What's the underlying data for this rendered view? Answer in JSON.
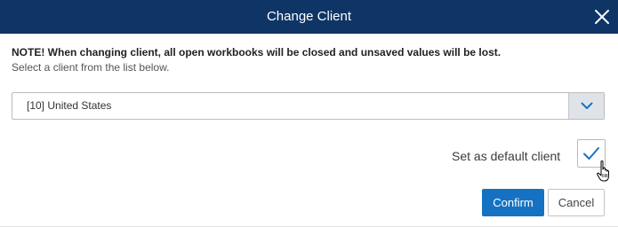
{
  "dialog": {
    "title": "Change Client",
    "close_icon": "close-icon"
  },
  "body": {
    "note": "NOTE! When changing client, all open workbooks will be closed and unsaved values will be lost.",
    "instruction": "Select a client from the list below."
  },
  "client_select": {
    "selected": "[10] United States",
    "arrow_icon": "chevron-down-icon"
  },
  "default_client": {
    "label": "Set as default client",
    "checked": true,
    "check_icon": "checkmark-icon"
  },
  "buttons": {
    "confirm": "Confirm",
    "cancel": "Cancel"
  },
  "colors": {
    "titlebar": "#0e3565",
    "accent": "#1572c3",
    "arrow_bg": "#dfe3e8"
  }
}
